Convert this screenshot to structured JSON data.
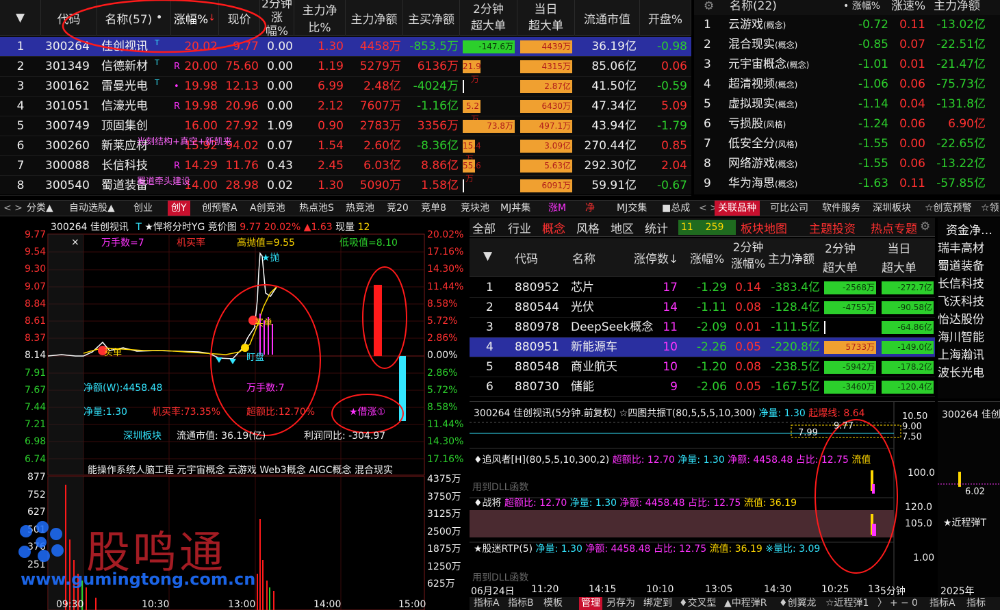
{
  "stock_table": {
    "headers": {
      "code": "代码",
      "name": "名称(57)",
      "dot": "•",
      "change": "涨幅%",
      "price": "现价",
      "twomin": "2分钟",
      "twomin_sub": "涨幅%",
      "main_ratio": "主力净比%",
      "main_net": "主力净额",
      "main_buy": "主买净额",
      "twomin2": "2分钟",
      "twomin2_sub": "超大单",
      "today": "当日",
      "today_sub": "超大单",
      "float_cap": "流通市值",
      "open": "开盘%"
    },
    "rows": [
      {
        "idx": "1",
        "code": "300264",
        "name": "佳创视讯",
        "tag": "T",
        "change": "20.02",
        "price": "9.77",
        "twomin": "0.00",
        "ratio": "1.30",
        "net": "4458万",
        "buy": "-853.5万",
        "bar1": "-147.6万",
        "bar2": "4439万",
        "cap": "36.19亿",
        "open": "-0.98"
      },
      {
        "idx": "2",
        "code": "301349",
        "name": "信德新材",
        "tag": "T",
        "mark": "R",
        "change": "20.00",
        "price": "75.60",
        "twomin": "0.00",
        "ratio": "1.19",
        "net": "5279万",
        "buy": "6136万",
        "bar1": "21.9万",
        "bar2": "4315万",
        "cap": "85.06亿",
        "open": "0.06"
      },
      {
        "idx": "3",
        "code": "300162",
        "name": "雷曼光电",
        "tag": "T",
        "mark": "•",
        "change": "19.98",
        "price": "12.13",
        "twomin": "0.00",
        "ratio": "6.99",
        "net": "2.48亿",
        "buy": "-4024万",
        "bar1": "",
        "bar2": "2.87亿",
        "cap": "41.50亿",
        "open": "-0.59"
      },
      {
        "idx": "4",
        "code": "301051",
        "name": "信濠光电",
        "tag": "",
        "mark": "R",
        "change": "19.98",
        "price": "20.96",
        "twomin": "0.00",
        "ratio": "2.12",
        "net": "7607万",
        "buy": "-1.16亿",
        "bar1": "5.2万",
        "bar2": "6430万",
        "cap": "47.34亿",
        "open": "5.09"
      },
      {
        "idx": "5",
        "code": "300749",
        "name": "顶固集创",
        "tag": "",
        "mark": "",
        "change": "16.00",
        "price": "27.92",
        "twomin": "1.09",
        "ratio": "0.90",
        "net": "2783万",
        "buy": "3356万",
        "bar1": "73.8万",
        "bar2": "497.1万",
        "cap": "43.94亿",
        "open": "-1.79"
      },
      {
        "idx": "6",
        "code": "300260",
        "name": "新莱应材",
        "tag": "",
        "mark": "",
        "note": "光刻结构+真空+新凯来",
        "change": "15.92",
        "price": "94.02",
        "twomin": "0.07",
        "ratio": "1.54",
        "net": "2.60亿",
        "buy": "-8.36亿",
        "bar1": "15.4万",
        "bar2": "3.09亿",
        "cap": "270.44亿",
        "open": "0.85"
      },
      {
        "idx": "7",
        "code": "300088",
        "name": "长信科技",
        "tag": "",
        "mark": "R",
        "change": "14.29",
        "price": "11.76",
        "twomin": "0.43",
        "ratio": "2.45",
        "net": "6.03亿",
        "buy": "8.86亿",
        "bar1": "55.6万",
        "bar2": "5.63亿",
        "cap": "292.30亿",
        "open": "2.04"
      },
      {
        "idx": "8",
        "code": "300540",
        "name": "蜀道装备",
        "tag": "",
        "mark": "",
        "note": "蜀道牵头建设",
        "change": "14.00",
        "price": "28.98",
        "twomin": "0.02",
        "ratio": "1.30",
        "net": "5090万",
        "buy": "1.58亿",
        "bar1": "",
        "bar2": "6091万",
        "cap": "59.91亿",
        "open": "-0.67"
      }
    ]
  },
  "concept_list": {
    "headers": {
      "name": "名称(22)",
      "dot": "•",
      "change": "涨幅%",
      "speed": "涨速%",
      "net": "主力净额"
    },
    "rows": [
      {
        "idx": "1",
        "name": "云游戏",
        "sub": "(概念)",
        "change": "-0.72",
        "speed": "0.11",
        "net": "-13.02亿"
      },
      {
        "idx": "2",
        "name": "混合现实",
        "sub": "(概念)",
        "change": "-0.85",
        "speed": "0.07",
        "net": "-22.51亿"
      },
      {
        "idx": "3",
        "name": "元宇宙概念",
        "sub": "(概念)",
        "change": "-1.01",
        "speed": "0.01",
        "net": "-21.47亿"
      },
      {
        "idx": "4",
        "name": "超清视频",
        "sub": "(概念)",
        "change": "-1.06",
        "speed": "0.06",
        "net": "-75.73亿"
      },
      {
        "idx": "5",
        "name": "虚拟现实",
        "sub": "(概念)",
        "change": "-1.14",
        "speed": "0.04",
        "net": "-131.8亿"
      },
      {
        "idx": "6",
        "name": "亏损股",
        "sub": "(风格)",
        "change": "-1.24",
        "speed": "0.06",
        "net": "6.90亿"
      },
      {
        "idx": "7",
        "name": "低安全分",
        "sub": "(风格)",
        "change": "-1.55",
        "speed": "0.00",
        "net": "-22.65亿"
      },
      {
        "idx": "8",
        "name": "网络游戏",
        "sub": "(概念)",
        "change": "-1.55",
        "speed": "0.06",
        "net": "-13.22亿"
      },
      {
        "idx": "9",
        "name": "华为海思",
        "sub": "(概念)",
        "change": "-1.63",
        "speed": "0.11",
        "net": "-57.85亿"
      }
    ]
  },
  "tabs_left": [
    "分类▲",
    "自动选股▲",
    "创业",
    "创Y",
    "创预警A",
    "A创竞池",
    "热点池S",
    "热竞池",
    "竞20",
    "竞单8",
    "竞块池",
    "MJ丼集",
    "涨M",
    "净",
    "MJ交集",
    "■总成"
  ],
  "tabs_right": [
    "关联品种",
    "可比公司",
    "软件服务",
    "深圳板块",
    "☆创宽预警",
    "☆领"
  ],
  "chart": {
    "title": "300264 佳创视讯",
    "tag": "T",
    "indicator": "★悍将分时YG 竞价图",
    "price": "9.77",
    "pct": "20.02%",
    "up": "▲1.63",
    "vol_label": "现量",
    "vol": "12",
    "close_x": "×",
    "wan": "万手数=7",
    "buy_rate": "机买率",
    "high_sell": "高抛值=9.55",
    "low_buy": "低吸值=8.10",
    "sell_tag": "★抛",
    "buy_tag": "买单",
    "buy_tag2": "买单",
    "pan": "盯盘",
    "net_w": "净额(W):4458.48",
    "wan2": "万手数:7",
    "net_qty": "净量:1.30",
    "buy_rate2": "机买率:73.35%",
    "super_ratio": "超额比:12.70%",
    "borrow": "★借涨①",
    "sector": "深圳板块",
    "cap": "流通市值:  36.19(亿)",
    "profit": "利润同比:  -304.97",
    "concepts": "能操作系统人脑工程 元宇宙概念 云游戏 Web3概念 AIGC概念 混合现实",
    "left_axis": [
      "9.77",
      "9.54",
      "9.30",
      "9.07",
      "8.84",
      "8.61",
      "8.37",
      "8.14",
      "7.91",
      "7.67",
      "7.44",
      "7.21",
      "6.98",
      "6.74"
    ],
    "right_axis": [
      "20.02%",
      "17.16%",
      "14.30%",
      "11.44%",
      "8.58%",
      "5.72%",
      "2.86%",
      "0.00%",
      "2.86%",
      "5.72%",
      "8.58%",
      "11.44%",
      "14.30%",
      "17.16%"
    ],
    "vol_axis_left": [
      "877",
      "752",
      "627",
      "501",
      "376",
      "251"
    ],
    "vol_axis_right": [
      "4375万",
      "3750万",
      "3125万",
      "2500万",
      "1875万",
      "1250万",
      "625万"
    ],
    "time_axis": [
      "09:30",
      "10:30",
      "13:00",
      "14:00",
      "15:00"
    ]
  },
  "watermark": {
    "cn": "股鸣通",
    "url": "www.gumingtong.com.cn"
  },
  "sector_tabs": [
    "全部",
    "行业",
    "概念",
    "风格",
    "地区",
    "统计"
  ],
  "sector_counts": {
    "a": "11",
    "b": "259"
  },
  "sector_links": [
    "板块地图",
    "主题投资",
    "热点专题"
  ],
  "sector_table": {
    "headers": {
      "code": "代码",
      "name": "名称",
      "limit": "涨停数↓",
      "change": "涨幅%",
      "twomin": "2分钟",
      "twomin_sub": "涨幅%",
      "net": "主力净额",
      "big": "2分钟",
      "big_sub": "超大单",
      "today": "当日",
      "today_sub": "超大单"
    },
    "rows": [
      {
        "idx": "1",
        "code": "880952",
        "name": "芯片",
        "limit": "17",
        "change": "-1.29",
        "twomin": "0.14",
        "net": "-383.4亿",
        "b1": "-2568万",
        "b2": "-272.7亿"
      },
      {
        "idx": "2",
        "code": "880544",
        "name": "光伏",
        "limit": "14",
        "change": "-1.11",
        "twomin": "0.08",
        "net": "-128.4亿",
        "b1": "-4755万",
        "b2": "-90.58亿"
      },
      {
        "idx": "3",
        "code": "880978",
        "name": "DeepSeek概念",
        "limit": "11",
        "change": "-2.09",
        "twomin": "0.01",
        "net": "-111.5亿",
        "b1": "",
        "b2": "-64.86亿"
      },
      {
        "idx": "4",
        "code": "880951",
        "name": "新能源车",
        "limit": "10",
        "change": "-2.26",
        "twomin": "0.05",
        "net": "-220.8亿",
        "b1": "5733万",
        "b2": "-149.0亿"
      },
      {
        "idx": "5",
        "code": "880548",
        "name": "商业航天",
        "limit": "10",
        "change": "-1.20",
        "twomin": "0.08",
        "net": "-238.5亿",
        "b1": "-5942万",
        "b2": "-178.2亿"
      },
      {
        "idx": "6",
        "code": "880730",
        "name": "储能",
        "limit": "9",
        "change": "-2.06",
        "twomin": "0.05",
        "net": "-167.5亿",
        "b1": "-3460万",
        "b2": "-120.4亿"
      }
    ]
  },
  "side_list": {
    "header": "资金净…",
    "items": [
      "瑞丰高材",
      "蜀道装备",
      "长信科技",
      "飞沃科技",
      "怡达股份",
      "海川智能",
      "上海瀚讯",
      "波长光电"
    ]
  },
  "lower": {
    "title": "300264 佳创视讯(5分钟.前复权)",
    "ind1": "☆四图共振T(80,5,5,5,10,300)",
    "ind1_vals": "净量: 1.30",
    "ind1_red": "起爆线: 8.64",
    "price_tag": "9.77",
    "price_tag2": "7.99",
    "axis1": [
      "10.50",
      "9.00",
      "7.50"
    ],
    "ind2": "♦追风者[H](80,5,5,10,300,2)",
    "ind2_a": "超额比: 12.70",
    "ind2_b": "净量: 1.30",
    "ind2_c": "净额: 4458.48",
    "ind2_d": "占比: 12.75",
    "ind2_e": "流值",
    "axis2": "100.0",
    "dll1": "用到DLL函数",
    "ind3": "♦战将",
    "ind3_a": "超额比: 12.70",
    "ind3_b": "净量: 1.30",
    "ind3_c": "净额: 4458.48",
    "ind3_d": "占比: 12.75",
    "ind3_e": "流值: 36.19",
    "axis3": [
      "120.0",
      "105.0"
    ],
    "ind4": "★股迷RTP(5)",
    "ind4_a": "净量: 1.30",
    "ind4_b": "净额: 4458.48",
    "ind4_c": "占比: 12.75",
    "ind4_d": "流值: 36.19",
    "ind4_e": "※量比: 3.09",
    "axis4": "1.00",
    "dll2": "用到DLL函数",
    "times": [
      "06月24日",
      "11:20",
      "14:15",
      "10:10",
      "13:05",
      "14:30",
      "10:25",
      "13",
      "5分钟",
      "2025年"
    ],
    "side_title": "300264 佳创",
    "side_val": "6.02",
    "side_tag": "★近程弹T"
  },
  "bottom_tabs": [
    "指标A",
    "指标B",
    "模板",
    "管理",
    "另存为",
    "绑定到",
    "♦交叉型",
    "▲中程弹R",
    "♦创翼龙",
    "☆近程弹1",
    "〉",
    "+",
    "−",
    "0",
    "指标A",
    "指标"
  ]
}
